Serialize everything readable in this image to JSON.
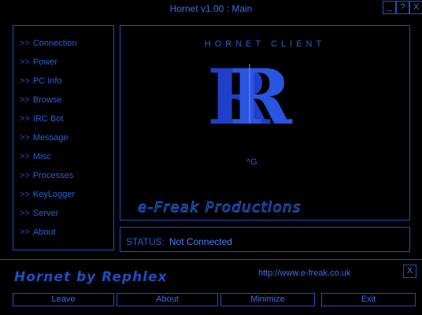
{
  "window": {
    "title": "Hornet v1.00 : Main",
    "min_label": "_",
    "help_label": "?",
    "close_label": "X"
  },
  "sidebar": {
    "arrow": ">>",
    "items": [
      {
        "label": "Connection"
      },
      {
        "label": "Power"
      },
      {
        "label": "PC Info"
      },
      {
        "label": "Browse"
      },
      {
        "label": "IRC Bot"
      },
      {
        "label": "Message"
      },
      {
        "label": "Misc"
      },
      {
        "label": "Processes"
      },
      {
        "label": "KeyLogger"
      },
      {
        "label": "Server"
      },
      {
        "label": "About"
      }
    ]
  },
  "main": {
    "client_label": "HORNET CLIENT",
    "logo_text": "RR",
    "cursor_text": "^G",
    "producer": "e-Freak Productions"
  },
  "status": {
    "label": "STATUS:",
    "value": "Not Connected"
  },
  "footer": {
    "brand": "Hornet by Rephlex",
    "url": "http://www.e-freak.co.uk",
    "close_label": "X"
  },
  "buttons": {
    "leave": "Leave",
    "about": "About",
    "minimize": "Minimize",
    "exit": "Exit"
  },
  "colors": {
    "background": "#000000",
    "accent": "#1f4fc0",
    "text": "#2a5fd6",
    "highlight": "#4a80ff"
  }
}
